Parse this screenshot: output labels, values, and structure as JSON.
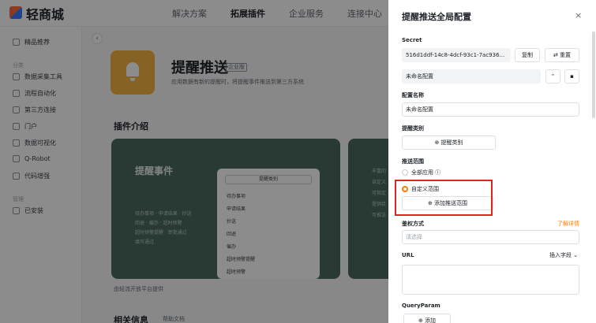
{
  "app": {
    "brand": "轻商城",
    "nav": [
      "解决方案",
      "拓展插件",
      "企业服务",
      "连接中心"
    ],
    "nav_active_index": 1
  },
  "sidebar": {
    "top_item": "精品推荐",
    "section1_head": "分类",
    "items": [
      "数据采集工具",
      "流程自动化",
      "第三方连接",
      "门户",
      "数据可视化",
      "Q-Robot",
      "代码增强"
    ],
    "section2_head": "管理",
    "installed": "已安装"
  },
  "plugin": {
    "title": "提醒推送",
    "badge": "企业版",
    "description": "应用数据有新的提醒时，将提醒事件推送到第三方系统",
    "intro_title": "插件介绍",
    "card": {
      "title": "提醒事件",
      "lines": [
        "待办事项 · 申请结果 · 抄送",
        "回退 · 催办 · 超时预警",
        "超时预警提醒 · 审批通过",
        "填写通过"
      ],
      "popup_header": "提醒类别",
      "popup_items": [
        "待办事项",
        "申请结果",
        "抄送",
        "回退",
        "催办",
        "超时预警提醒",
        "超时预警"
      ]
    },
    "card2_lines": [
      "丰富的",
      "自定义",
      "可指定",
      "提供给",
      "可推送"
    ],
    "footnote": "由轻流开放平台提供",
    "related_title": "相关信息",
    "related_link": "帮助文档"
  },
  "drawer": {
    "title": "提醒推送全局配置",
    "close": "×",
    "secret_label": "Secret",
    "secret_value": "516d1ddf-14c8-4dcf-93c1-7ac936...",
    "copy_button": "复制",
    "reset_button": "⇄ 重置",
    "config_name_display": "未命名配置",
    "config_name_label": "配置名称",
    "config_name_value": "未命名配置",
    "reminder_label": "提醒类别",
    "reminder_button": "⊕ 提醒类别",
    "scope_label": "推送范围",
    "scope_all": "全部应用 ⓘ",
    "scope_custom": "自定义范围",
    "add_scope_button": "⊕ 添加推送范围",
    "auth_label": "鉴权方式",
    "auth_link": "了解详情",
    "auth_placeholder": "请选择",
    "url_label": "URL",
    "insert_field": "插入字段",
    "query_label": "QueryParam",
    "add_button": "⊕ 添加"
  },
  "colors": {
    "accent": "#ff7d00",
    "highlight_box": "#e02424",
    "plugin_icon": "#f5b342",
    "card_bg": "#4a6b5e"
  }
}
